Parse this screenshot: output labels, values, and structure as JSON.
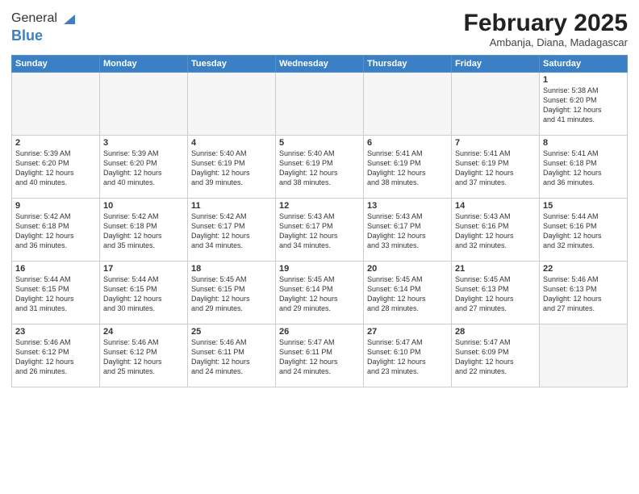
{
  "logo": {
    "general": "General",
    "blue": "Blue"
  },
  "header": {
    "title": "February 2025",
    "subtitle": "Ambanja, Diana, Madagascar"
  },
  "weekdays": [
    "Sunday",
    "Monday",
    "Tuesday",
    "Wednesday",
    "Thursday",
    "Friday",
    "Saturday"
  ],
  "weeks": [
    [
      {
        "day": "",
        "empty": true
      },
      {
        "day": "",
        "empty": true
      },
      {
        "day": "",
        "empty": true
      },
      {
        "day": "",
        "empty": true
      },
      {
        "day": "",
        "empty": true
      },
      {
        "day": "",
        "empty": true
      },
      {
        "day": "1",
        "info": "Sunrise: 5:38 AM\nSunset: 6:20 PM\nDaylight: 12 hours\nand 41 minutes."
      }
    ],
    [
      {
        "day": "2",
        "info": "Sunrise: 5:39 AM\nSunset: 6:20 PM\nDaylight: 12 hours\nand 40 minutes."
      },
      {
        "day": "3",
        "info": "Sunrise: 5:39 AM\nSunset: 6:20 PM\nDaylight: 12 hours\nand 40 minutes."
      },
      {
        "day": "4",
        "info": "Sunrise: 5:40 AM\nSunset: 6:19 PM\nDaylight: 12 hours\nand 39 minutes."
      },
      {
        "day": "5",
        "info": "Sunrise: 5:40 AM\nSunset: 6:19 PM\nDaylight: 12 hours\nand 38 minutes."
      },
      {
        "day": "6",
        "info": "Sunrise: 5:41 AM\nSunset: 6:19 PM\nDaylight: 12 hours\nand 38 minutes."
      },
      {
        "day": "7",
        "info": "Sunrise: 5:41 AM\nSunset: 6:19 PM\nDaylight: 12 hours\nand 37 minutes."
      },
      {
        "day": "8",
        "info": "Sunrise: 5:41 AM\nSunset: 6:18 PM\nDaylight: 12 hours\nand 36 minutes."
      }
    ],
    [
      {
        "day": "9",
        "info": "Sunrise: 5:42 AM\nSunset: 6:18 PM\nDaylight: 12 hours\nand 36 minutes."
      },
      {
        "day": "10",
        "info": "Sunrise: 5:42 AM\nSunset: 6:18 PM\nDaylight: 12 hours\nand 35 minutes."
      },
      {
        "day": "11",
        "info": "Sunrise: 5:42 AM\nSunset: 6:17 PM\nDaylight: 12 hours\nand 34 minutes."
      },
      {
        "day": "12",
        "info": "Sunrise: 5:43 AM\nSunset: 6:17 PM\nDaylight: 12 hours\nand 34 minutes."
      },
      {
        "day": "13",
        "info": "Sunrise: 5:43 AM\nSunset: 6:17 PM\nDaylight: 12 hours\nand 33 minutes."
      },
      {
        "day": "14",
        "info": "Sunrise: 5:43 AM\nSunset: 6:16 PM\nDaylight: 12 hours\nand 32 minutes."
      },
      {
        "day": "15",
        "info": "Sunrise: 5:44 AM\nSunset: 6:16 PM\nDaylight: 12 hours\nand 32 minutes."
      }
    ],
    [
      {
        "day": "16",
        "info": "Sunrise: 5:44 AM\nSunset: 6:15 PM\nDaylight: 12 hours\nand 31 minutes."
      },
      {
        "day": "17",
        "info": "Sunrise: 5:44 AM\nSunset: 6:15 PM\nDaylight: 12 hours\nand 30 minutes."
      },
      {
        "day": "18",
        "info": "Sunrise: 5:45 AM\nSunset: 6:15 PM\nDaylight: 12 hours\nand 29 minutes."
      },
      {
        "day": "19",
        "info": "Sunrise: 5:45 AM\nSunset: 6:14 PM\nDaylight: 12 hours\nand 29 minutes."
      },
      {
        "day": "20",
        "info": "Sunrise: 5:45 AM\nSunset: 6:14 PM\nDaylight: 12 hours\nand 28 minutes."
      },
      {
        "day": "21",
        "info": "Sunrise: 5:45 AM\nSunset: 6:13 PM\nDaylight: 12 hours\nand 27 minutes."
      },
      {
        "day": "22",
        "info": "Sunrise: 5:46 AM\nSunset: 6:13 PM\nDaylight: 12 hours\nand 27 minutes."
      }
    ],
    [
      {
        "day": "23",
        "info": "Sunrise: 5:46 AM\nSunset: 6:12 PM\nDaylight: 12 hours\nand 26 minutes."
      },
      {
        "day": "24",
        "info": "Sunrise: 5:46 AM\nSunset: 6:12 PM\nDaylight: 12 hours\nand 25 minutes."
      },
      {
        "day": "25",
        "info": "Sunrise: 5:46 AM\nSunset: 6:11 PM\nDaylight: 12 hours\nand 24 minutes."
      },
      {
        "day": "26",
        "info": "Sunrise: 5:47 AM\nSunset: 6:11 PM\nDaylight: 12 hours\nand 24 minutes."
      },
      {
        "day": "27",
        "info": "Sunrise: 5:47 AM\nSunset: 6:10 PM\nDaylight: 12 hours\nand 23 minutes."
      },
      {
        "day": "28",
        "info": "Sunrise: 5:47 AM\nSunset: 6:09 PM\nDaylight: 12 hours\nand 22 minutes."
      },
      {
        "day": "",
        "empty": true
      }
    ]
  ]
}
